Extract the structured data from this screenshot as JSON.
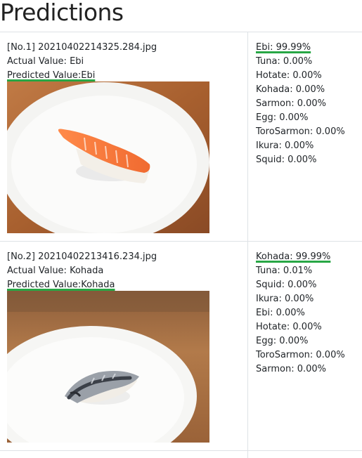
{
  "page": {
    "title": "Predictions"
  },
  "rows": [
    {
      "header": "[No.1] 20210402214325.284.jpg",
      "actual": "Actual Value: Ebi",
      "predicted": "Predicted Value:Ebi",
      "image_subject": "ebi-nigiri-on-plate",
      "scores": [
        "Ebi: 99.99%",
        "Tuna: 0.00%",
        "Hotate: 0.00%",
        "Kohada: 0.00%",
        "Sarmon: 0.00%",
        "Egg: 0.00%",
        "ToroSarmon: 0.00%",
        "Ikura: 0.00%",
        "Squid: 0.00%"
      ]
    },
    {
      "header": "[No.2] 20210402213416.234.jpg",
      "actual": "Actual Value: Kohada",
      "predicted": "Predicted Value:Kohada",
      "image_subject": "kohada-nigiri-on-plate",
      "scores": [
        "Kohada: 99.99%",
        "Tuna: 0.01%",
        "Squid: 0.00%",
        "Ikura: 0.00%",
        "Ebi: 0.00%",
        "Hotate: 0.00%",
        "Egg: 0.00%",
        "ToroSarmon: 0.00%",
        "Sarmon: 0.00%"
      ]
    }
  ],
  "colors": {
    "highlight": "#28a745",
    "border": "#dee2e6",
    "text": "#212529"
  }
}
